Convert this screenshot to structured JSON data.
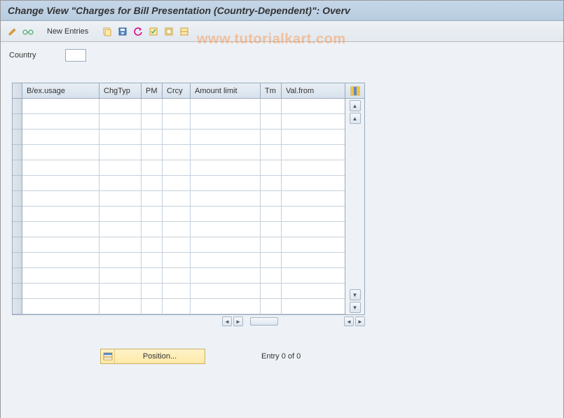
{
  "title": "Change View \"Charges for Bill Presentation (Country-Dependent)\": Overv",
  "toolbar": {
    "new_entries_label": "New Entries"
  },
  "watermark": "www.tutorialkart.com",
  "field": {
    "country_label": "Country",
    "country_value": ""
  },
  "table": {
    "columns": {
      "bex": "B/ex.usage",
      "chgtyp": "ChgTyp",
      "pm": "PM",
      "crcy": "Crcy",
      "amount": "Amount limit",
      "tm": "Tm",
      "valfrom": "Val.from"
    },
    "row_count": 14
  },
  "footer": {
    "position_label": "Position...",
    "entry_text": "Entry 0 of 0"
  }
}
